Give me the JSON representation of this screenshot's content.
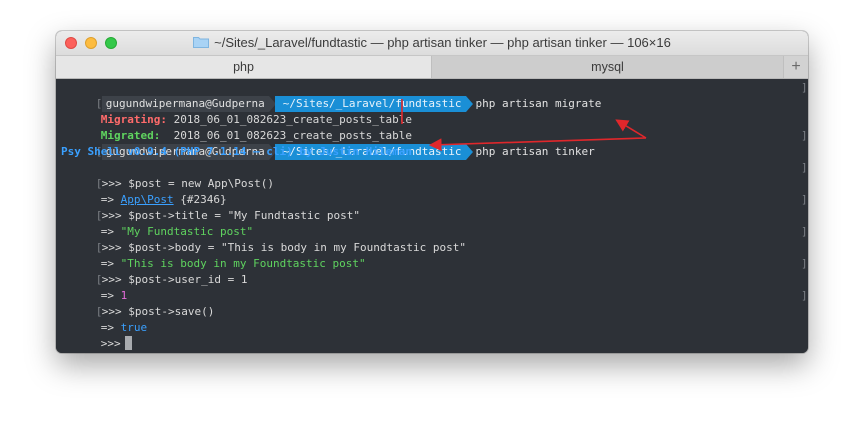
{
  "window": {
    "title": "~/Sites/_Laravel/fundtastic — php artisan tinker — php artisan tinker — 106×16"
  },
  "tabs": [
    {
      "label": "php",
      "active": true
    },
    {
      "label": "mysql",
      "active": false
    }
  ],
  "tab_add_label": "+",
  "colors": {
    "path_segment": "#1a8fd6",
    "migrating": "#ff6b6b",
    "migrated": "#5fd35f",
    "string": "#5fd35f",
    "number": "#e36cd9",
    "keyword": "#3aa0ff",
    "annotation": "#e0272b"
  },
  "terminal": {
    "prompt1": {
      "user": "gugundwipermana@Gudperna",
      "path": "~/Sites/_Laravel/fundtastic",
      "command": "php artisan migrate"
    },
    "migrating": {
      "label": "Migrating:",
      "value": "2018_06_01_082623_create_posts_table"
    },
    "migrated": {
      "label": "Migrated:",
      "value": "2018_06_01_082623_create_posts_table"
    },
    "prompt2": {
      "user": "gugundwipermana@Gudperna",
      "path": "~/Sites/_Laravel/fundtastic",
      "command": "php artisan tinker"
    },
    "psy_banner": "Psy Shell v0.9.4 (PHP 7.1.14 — cli) by Justin Hileman",
    "repl": [
      {
        "prompt": ">>>",
        "input": "$post = new App\\Post()"
      },
      {
        "result_prefix": "=>",
        "result_link": "App\\Post",
        "result_rest": "{#2346}"
      },
      {
        "prompt": ">>>",
        "input": "$post->title = \"My Fundtastic post\""
      },
      {
        "result_prefix": "=>",
        "result_string": "\"My Fundtastic post\""
      },
      {
        "prompt": ">>>",
        "input": "$post->body = \"This is body in my Foundtastic post\""
      },
      {
        "result_prefix": "=>",
        "result_string": "\"This is body in my Foundtastic post\""
      },
      {
        "prompt": ">>>",
        "input": "$post->user_id = 1"
      },
      {
        "result_prefix": "=>",
        "result_number": "1"
      },
      {
        "prompt": ">>>",
        "input": "$post->save()"
      },
      {
        "result_prefix": "=>",
        "result_keyword": "true"
      },
      {
        "prompt": ">>>",
        "input": ""
      }
    ],
    "left_bracket": "[",
    "right_bracket": "]"
  }
}
